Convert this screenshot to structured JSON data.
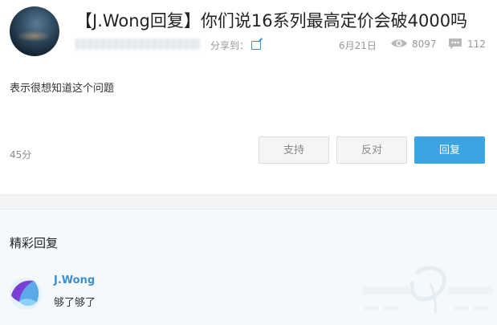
{
  "post": {
    "title": "【J.Wong回复】你们说16系列最高定价会破4000吗",
    "share_label": "分享到：",
    "date": "6月21日",
    "views": "8097",
    "comments": "112",
    "body": "表示很想知道这个问题",
    "score": "45分"
  },
  "actions": {
    "support_label": "支持",
    "oppose_label": "反对",
    "reply_label": "回复"
  },
  "replies": {
    "section_title": "精彩回复",
    "items": [
      {
        "username": "J.Wong",
        "text": "够了够了"
      }
    ]
  },
  "icons": {
    "share": "share-external-icon",
    "views": "eye-icon",
    "comments": "comment-bubble-icon"
  },
  "colors": {
    "accent": "#3aa5e0",
    "link": "#3a8fd0",
    "meta": "#999999"
  }
}
